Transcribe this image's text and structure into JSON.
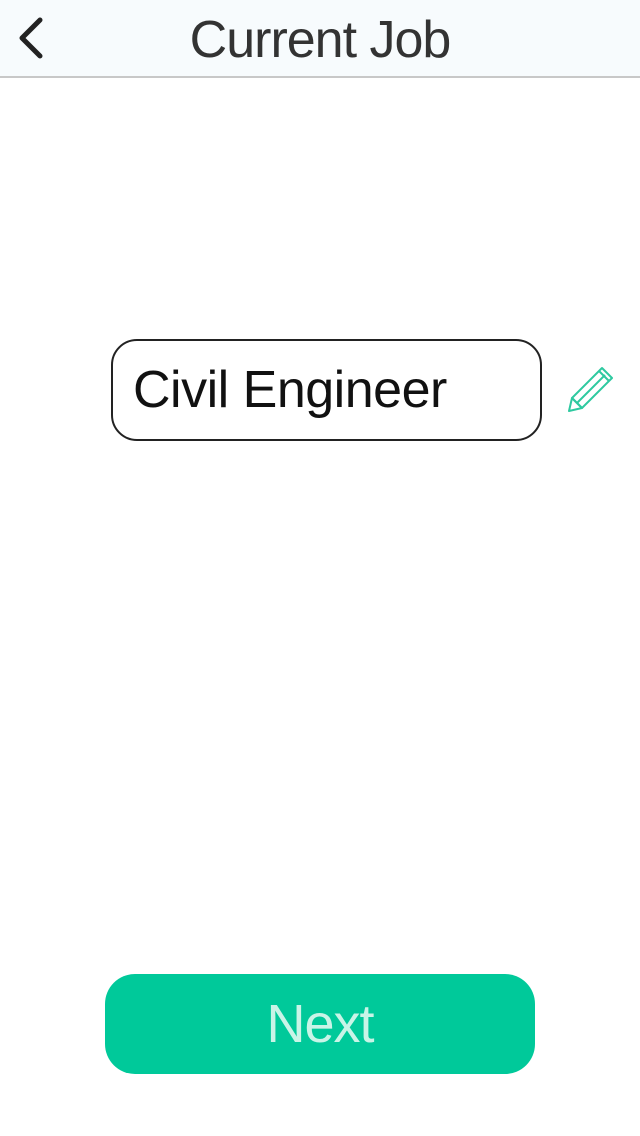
{
  "nav": {
    "title": "Current Job",
    "back_icon": "chevron-left-icon"
  },
  "job": {
    "value": "Civil Engineer",
    "edit_icon": "pencil-icon"
  },
  "actions": {
    "next_label": "Next"
  },
  "colors": {
    "accent": "#00c99a",
    "nav_background": "#f7fbfd",
    "pencil": "#2ec9a0"
  }
}
